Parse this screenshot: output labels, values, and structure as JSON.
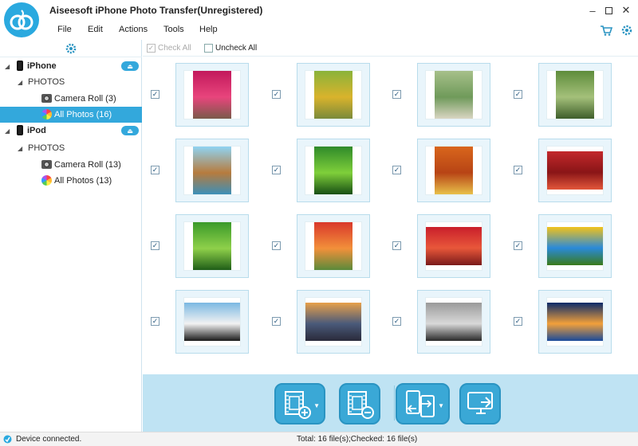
{
  "window": {
    "title": "Aiseesoft iPhone Photo Transfer(Unregistered)",
    "controls": [
      "minimize",
      "maximize",
      "close"
    ]
  },
  "menu": {
    "items": [
      {
        "label": "File",
        "icon": null
      },
      {
        "label": "Edit",
        "icon": null
      },
      {
        "label": "Actions",
        "icon": null
      },
      {
        "label": "Tools",
        "icon": null
      },
      {
        "label": "Help",
        "icon": null
      }
    ],
    "right_icons": [
      "cart-icon",
      "gear-icon"
    ]
  },
  "sidebar": {
    "settings_icon": "gear-icon",
    "devices": [
      {
        "name": "iPhone",
        "icon": "phone-icon",
        "eject_icon": "eject-icon",
        "group": "PHOTOS",
        "items": [
          {
            "label": "Camera Roll (3)",
            "icon": "camera-icon",
            "selected": false
          },
          {
            "label": "All Photos (16)",
            "icon": "photos-icon",
            "selected": true
          }
        ]
      },
      {
        "name": "iPod",
        "icon": "ipod-icon",
        "eject_icon": "eject-icon",
        "group": "PHOTOS",
        "items": [
          {
            "label": "Camera Roll (13)",
            "icon": "camera-icon",
            "selected": false
          },
          {
            "label": "All Photos (13)",
            "icon": "photos-icon",
            "selected": false
          }
        ]
      }
    ]
  },
  "content": {
    "check_all_label": "Check All",
    "uncheck_all_label": "Uncheck All",
    "photos": [
      {
        "subject": "red-tree-road",
        "checked": true,
        "colors": [
          "#c2185b",
          "#e8457c",
          "#7a5a4a"
        ]
      },
      {
        "subject": "autumn-park",
        "checked": true,
        "colors": [
          "#8ab33a",
          "#d9b32c",
          "#7a8a3a"
        ]
      },
      {
        "subject": "garden-arch",
        "checked": true,
        "colors": [
          "#a7c08a",
          "#6f9a5a",
          "#d9d5c2"
        ]
      },
      {
        "subject": "green-arch-path",
        "checked": true,
        "colors": [
          "#5e8c3b",
          "#a4c07a",
          "#3e5e2a"
        ]
      },
      {
        "subject": "rock-island",
        "checked": true,
        "colors": [
          "#8fd3f2",
          "#b77b3d",
          "#3c8fb8"
        ]
      },
      {
        "subject": "green-tunnel",
        "checked": true,
        "colors": [
          "#2f8a2a",
          "#7fcf3a",
          "#174f14"
        ]
      },
      {
        "subject": "autumn-path",
        "checked": true,
        "colors": [
          "#d9661c",
          "#b84415",
          "#e8c04a"
        ]
      },
      {
        "subject": "red-forest",
        "checked": true,
        "colors": [
          "#c2282b",
          "#8a1517",
          "#e2573a"
        ]
      },
      {
        "subject": "green-trees",
        "checked": true,
        "colors": [
          "#3a9a2a",
          "#8fd04a",
          "#1f5e18"
        ]
      },
      {
        "subject": "red-bench-path",
        "checked": true,
        "colors": [
          "#d9382b",
          "#f2903a",
          "#5a8a3a"
        ]
      },
      {
        "subject": "red-canopy",
        "checked": true,
        "colors": [
          "#c91f2b",
          "#e8573a",
          "#7a1a1a"
        ]
      },
      {
        "subject": "yellow-tulips",
        "checked": true,
        "colors": [
          "#f2c21a",
          "#2a8ad9",
          "#3a7a1a"
        ]
      },
      {
        "subject": "penguins",
        "checked": true,
        "colors": [
          "#7ab8e2",
          "#f2f2f2",
          "#1a1a1a"
        ]
      },
      {
        "subject": "castle-sunset",
        "checked": true,
        "colors": [
          "#e8a04a",
          "#4a5a7a",
          "#2a2a3a"
        ]
      },
      {
        "subject": "koala",
        "checked": true,
        "colors": [
          "#9a9a9a",
          "#d9d9d9",
          "#2a2a2a"
        ]
      },
      {
        "subject": "jellyfish",
        "checked": true,
        "colors": [
          "#0a2a6a",
          "#f2a03a",
          "#1a4a9a"
        ]
      }
    ]
  },
  "toolbar": {
    "buttons": [
      {
        "name": "add-photo-button",
        "icon": "film-add-icon",
        "has_dropdown": true
      },
      {
        "name": "delete-photo-button",
        "icon": "film-remove-icon",
        "has_dropdown": false
      },
      {
        "name": "transfer-device-button",
        "icon": "device-transfer-icon",
        "has_dropdown": true
      },
      {
        "name": "export-pc-button",
        "icon": "export-to-pc-icon",
        "has_dropdown": false
      }
    ]
  },
  "status": {
    "connection": "Device connected.",
    "total": "Total: 16 file(s);Checked: 16 file(s)"
  },
  "colors": {
    "accent": "#33a8dc",
    "toolbar_bg": "#bfe3f3",
    "thumb_bg": "#e9f5fb"
  }
}
